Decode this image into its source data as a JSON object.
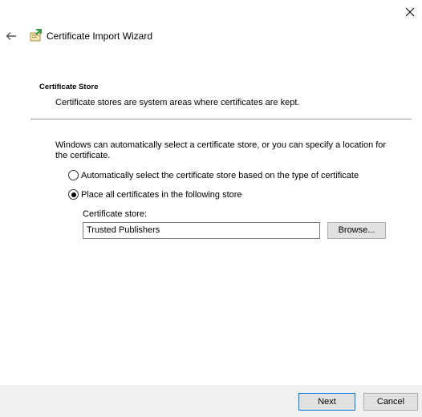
{
  "window": {
    "close_icon": "close-icon"
  },
  "header": {
    "back_icon": "back-arrow-icon",
    "wizard_icon": "certificate-icon",
    "title": "Certificate Import Wizard"
  },
  "section": {
    "title": "Certificate Store",
    "description": "Certificate stores are system areas where certificates are kept."
  },
  "main": {
    "intro": "Windows can automatically select a certificate store, or you can specify a location for the certificate.",
    "options": [
      {
        "label": "Automatically select the certificate store based on the type of certificate",
        "checked": false
      },
      {
        "label": "Place all certificates in the following store",
        "checked": true
      }
    ],
    "store_label": "Certificate store:",
    "store_value": "Trusted Publishers",
    "browse_label": "Browse..."
  },
  "footer": {
    "next_label": "Next",
    "cancel_label": "Cancel"
  },
  "colors": {
    "accent": "#0078d7",
    "footer_bg": "#f0f0f0",
    "button_bg": "#e1e1e1"
  }
}
